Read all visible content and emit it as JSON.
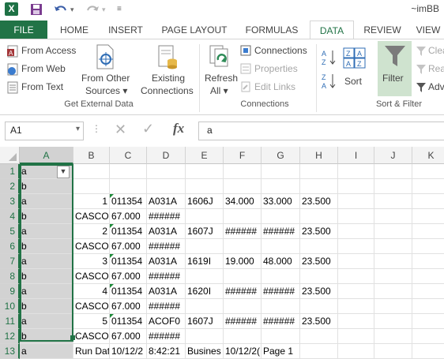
{
  "titlebar": {
    "app_icon": "X",
    "doc_title": "~imBB"
  },
  "quick_access": {
    "save_icon": "save-icon",
    "undo_icon": "undo-icon",
    "redo_icon": "redo-icon",
    "customize_icon": "customize-icon"
  },
  "tabs": [
    "FILE",
    "HOME",
    "INSERT",
    "PAGE LAYOUT",
    "FORMULAS",
    "DATA",
    "REVIEW",
    "VIEW"
  ],
  "ribbon": {
    "get_external": {
      "from_access": "From Access",
      "from_web": "From Web",
      "from_text": "From Text",
      "from_other_1": "From Other",
      "from_other_2": "Sources ▾",
      "existing_1": "Existing",
      "existing_2": "Connections",
      "label": "Get External Data"
    },
    "connections": {
      "refresh_1": "Refresh",
      "refresh_2": "All ▾",
      "connections": "Connections",
      "properties": "Properties",
      "edit_links": "Edit Links",
      "label": "Connections"
    },
    "sort_filter": {
      "sort": "Sort",
      "filter": "Filter",
      "clear": "Clea",
      "reapply": "Rea",
      "advanced": "Adv",
      "label": "Sort & Filter"
    }
  },
  "formula_bar": {
    "name_box": "A1",
    "fx": "fx",
    "content": "a"
  },
  "grid": {
    "columns": [
      "A",
      "B",
      "C",
      "D",
      "E",
      "F",
      "G",
      "H",
      "I",
      "J",
      "K"
    ],
    "rows": [
      "1",
      "2",
      "3",
      "4",
      "5",
      "6",
      "7",
      "8",
      "9",
      "10",
      "11",
      "12",
      "13"
    ],
    "data": [
      [
        "a",
        "",
        "",
        "",
        "",
        "",
        "",
        "",
        "",
        "",
        ""
      ],
      [
        "b",
        "",
        "",
        "",
        "",
        "",
        "",
        "",
        "",
        "",
        ""
      ],
      [
        "a",
        "1",
        "011354",
        "A031A",
        "1606J",
        "34.000",
        "33.000",
        "23.500",
        "",
        "",
        ""
      ],
      [
        "b",
        "CASCONE'S SA",
        "67.000",
        "######",
        "",
        "",
        "",
        "",
        "",
        "",
        ""
      ],
      [
        "a",
        "2",
        "011354",
        "A031A",
        "1607J",
        "######",
        "######",
        "23.500",
        "",
        "",
        ""
      ],
      [
        "b",
        "CASCONE'S SA",
        "67.000",
        "######",
        "",
        "",
        "",
        "",
        "",
        "",
        ""
      ],
      [
        "a",
        "3",
        "011354",
        "A031A",
        "1619I",
        "19.000",
        "48.000",
        "23.500",
        "",
        "",
        ""
      ],
      [
        "b",
        "CASCONE'S SA",
        "67.000",
        "######",
        "",
        "",
        "",
        "",
        "",
        "",
        ""
      ],
      [
        "a",
        "4",
        "011354",
        "A031A",
        "1620I",
        "######",
        "######",
        "23.500",
        "",
        "",
        ""
      ],
      [
        "b",
        "CASCONE'S SA",
        "67.000",
        "######",
        "",
        "",
        "",
        "",
        "",
        "",
        ""
      ],
      [
        "a",
        "5",
        "011354",
        "ACOF0",
        "1607J",
        "######",
        "######",
        "23.500",
        "",
        "",
        ""
      ],
      [
        "b",
        "CASCONE'S SA",
        "67.000",
        "######",
        "",
        "",
        "",
        "",
        "",
        "",
        ""
      ],
      [
        "a",
        "Run Dat",
        "10/12/2",
        "8:42:21",
        "Busines",
        "10/12/2(",
        "Page  1",
        "",
        "",
        "",
        ""
      ]
    ]
  },
  "colors": {
    "accent": "#217346",
    "selection": "#d5d5d5"
  }
}
